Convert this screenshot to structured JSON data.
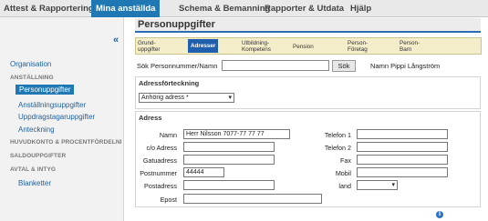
{
  "topnav": {
    "tabs": [
      "Attest & Rapportering",
      "Mina anställda",
      "Schema & Bemanning",
      "Rapporter & Utdata",
      "Hjälp"
    ]
  },
  "sidebar": {
    "collapse_label": "«",
    "organisation": "Organisation",
    "anstallning_header": "ANSTÄLLNING",
    "items": [
      "Personuppgifter",
      "Anställningsuppgifter",
      "Uppdragstagaruppgifter",
      "Anteckning"
    ],
    "huvudkonto_header": "HUVUDKONTO & PROCENTFÖRDELNI",
    "saldo_header": "SALDOUPPGIFTER",
    "avtal_header": "AVTAL & INTYG",
    "blanketter": "Blanketter"
  },
  "page": {
    "title": "Personuppgifter",
    "subtabs": [
      {
        "line1": "Grund-",
        "line2": "uppgifter"
      },
      {
        "line1": "Adresser",
        "line2": ""
      },
      {
        "line1": "Utbildning-",
        "line2": "Kompetens"
      },
      {
        "line1": "Pension",
        "line2": ""
      },
      {
        "line1": "Person-",
        "line2": "Företag"
      },
      {
        "line1": "Person-",
        "line2": "Barn"
      }
    ]
  },
  "search": {
    "label": "Sök Personnummer/Namn",
    "value": "",
    "button": "Sök",
    "name_info": "Namn Pippi Långström"
  },
  "adressforteckning": {
    "title": "Adressförteckning",
    "selected": "Anhörig adress *"
  },
  "adress": {
    "title": "Adress",
    "labels": {
      "namn": "Namn",
      "co": "c/o Adress",
      "gatu": "Gatuadress",
      "postnr": "Postnummer",
      "postadress": "Postadress",
      "epost": "Epost",
      "tel1": "Telefon 1",
      "tel2": "Telefon 2",
      "fax": "Fax",
      "mobil": "Mobil",
      "land": "land"
    },
    "values": {
      "namn": "Herr Nilsson 7077-77 77 77",
      "co": "",
      "gatu": "",
      "postnr": "44444",
      "postadress": "",
      "epost": "",
      "tel1": "",
      "tel2": "",
      "fax": "",
      "mobil": "",
      "land": ""
    }
  },
  "icons": {
    "info": "i",
    "dropdown": "▾"
  },
  "colors": {
    "nav_active": "#1f78b4",
    "subtab_bg": "#f3edc9",
    "link": "#1f5f9f"
  }
}
